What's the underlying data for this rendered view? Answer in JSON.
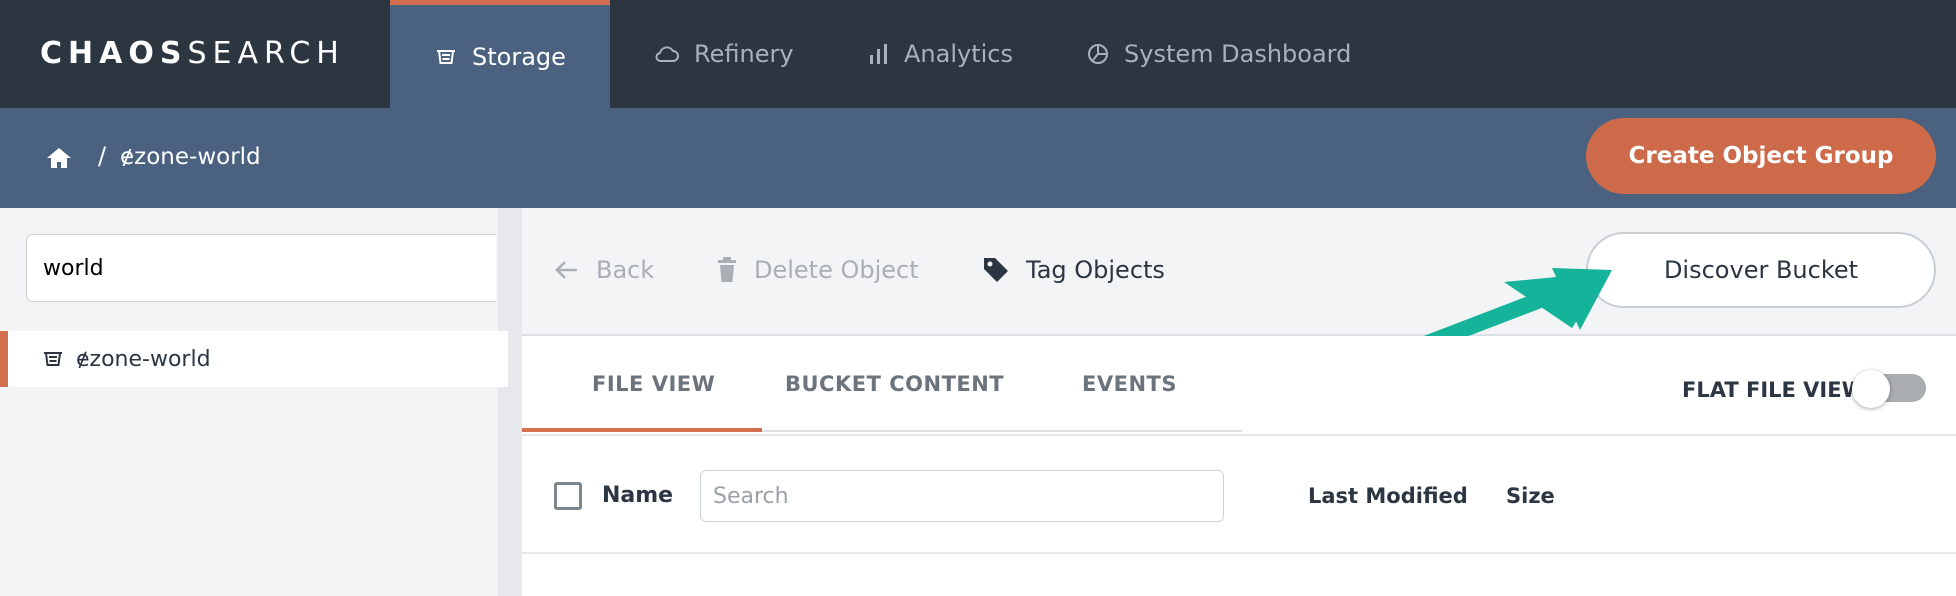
{
  "brand": {
    "logo_bold": "CHAOS",
    "logo_light": "SEARCH"
  },
  "nav": {
    "tabs": [
      {
        "label": "Storage",
        "icon": "storage-icon",
        "active": true
      },
      {
        "label": "Refinery",
        "icon": "cloud-icon",
        "active": false
      },
      {
        "label": "Analytics",
        "icon": "bar-chart-icon",
        "active": false
      },
      {
        "label": "System Dashboard",
        "icon": "dashboard-icon",
        "active": false
      }
    ]
  },
  "breadcrumb": {
    "separator": "/",
    "current": "ɇzone-world"
  },
  "header": {
    "create_label": "Create Object Group"
  },
  "sidebar": {
    "search_value": "world",
    "items": [
      {
        "label": "ɇzone-world",
        "icon": "storage-icon",
        "selected": true
      }
    ]
  },
  "toolbar": {
    "back_label": "Back",
    "delete_label": "Delete Object",
    "tag_label": "Tag Objects",
    "discover_label": "Discover Bucket"
  },
  "view_tabs": {
    "items": [
      {
        "label": "FILE VIEW",
        "active": true
      },
      {
        "label": "BUCKET CONTENT",
        "active": false
      },
      {
        "label": "EVENTS",
        "active": false
      }
    ],
    "flat_file_label": "FLAT FILE VIEW",
    "flat_file_on": false
  },
  "table": {
    "name_header": "Name",
    "search_placeholder": "Search",
    "modified_header": "Last Modified",
    "size_header": "Size"
  },
  "colors": {
    "nav_bg": "#2b3640",
    "subbar_bg": "#4a6180",
    "accent": "#cc6a4a",
    "annotation_arrow": "#14b39a"
  }
}
